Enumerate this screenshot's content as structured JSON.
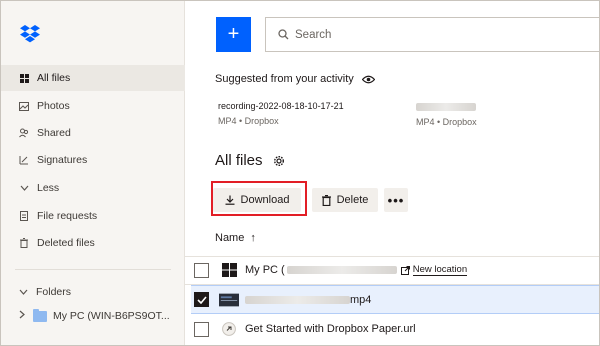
{
  "sidebar": {
    "items": [
      {
        "label": "All files",
        "icon": "all-files-icon",
        "active": true
      },
      {
        "label": "Photos",
        "icon": "photos-icon"
      },
      {
        "label": "Shared",
        "icon": "shared-icon"
      },
      {
        "label": "Signatures",
        "icon": "signatures-icon"
      },
      {
        "label": "Less",
        "icon": "chevron-down-icon"
      },
      {
        "label": "File requests",
        "icon": "file-requests-icon"
      },
      {
        "label": "Deleted files",
        "icon": "trash-icon"
      }
    ],
    "folders_label": "Folders",
    "folder_item": "My PC (WIN-B6PS9OT..."
  },
  "header": {
    "create_label": "+",
    "search_placeholder": "Search"
  },
  "suggested": {
    "title": "Suggested from your activity",
    "items": [
      {
        "name": "recording-2022-08-18-10-17-21",
        "meta": "MP4 • Dropbox"
      },
      {
        "name": "",
        "meta": "MP4 • Dropbox"
      }
    ]
  },
  "main": {
    "title": "All files",
    "download_label": "Download",
    "delete_label": "Delete",
    "more_label": "•••",
    "column_name": "Name",
    "sort_arrow": "↑"
  },
  "files": [
    {
      "name_prefix": "My PC (",
      "name_suffix": "",
      "new_location": "New location",
      "checked": false
    },
    {
      "name_prefix": "",
      "name_suffix": "mp4",
      "checked": true
    },
    {
      "name_prefix": "Get Started with Dropbox Paper.url",
      "name_suffix": "",
      "checked": false
    }
  ],
  "colors": {
    "accent": "#0061fe",
    "highlight": "#e21e26",
    "selected_row": "#e8f0fd"
  }
}
